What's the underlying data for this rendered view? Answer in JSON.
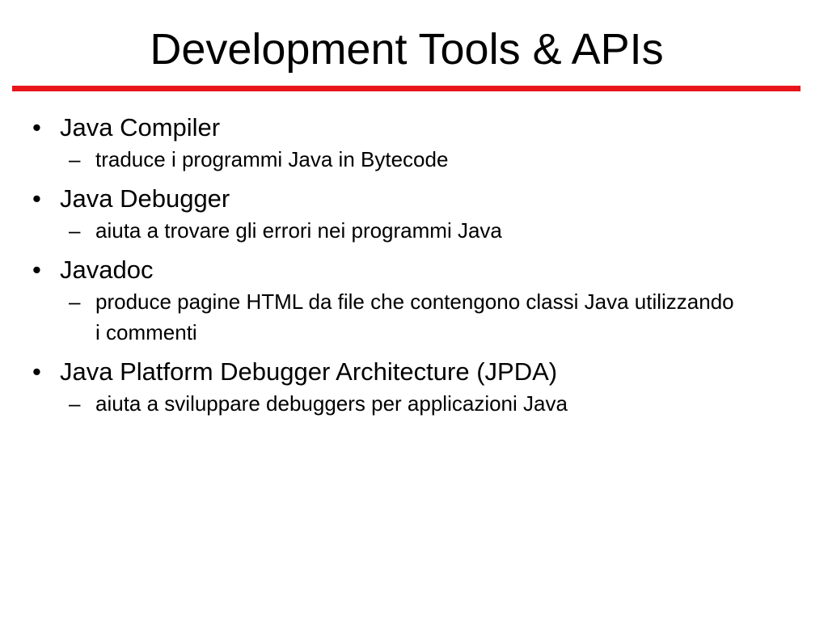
{
  "slide": {
    "title": "Development Tools & APIs",
    "accent_color": "#e8151b",
    "bullets": [
      {
        "text": "Java Compiler",
        "marker": "•",
        "sub": [
          {
            "marker": "–",
            "text": "traduce i programmi Java in Bytecode"
          }
        ]
      },
      {
        "text": "Java Debugger",
        "marker": "•",
        "sub": [
          {
            "marker": "–",
            "text": "aiuta a trovare gli errori nei programmi Java"
          }
        ]
      },
      {
        "text": "Javadoc",
        "marker": "•",
        "sub": [
          {
            "marker": "–",
            "text": "produce pagine HTML da file che contengono classi Java utilizzando i commenti"
          }
        ]
      },
      {
        "text": "Java Platform Debugger Architecture (JPDA)",
        "marker": "•",
        "sub": [
          {
            "marker": "–",
            "text": "aiuta a sviluppare debuggers per applicazioni Java"
          }
        ]
      }
    ]
  }
}
